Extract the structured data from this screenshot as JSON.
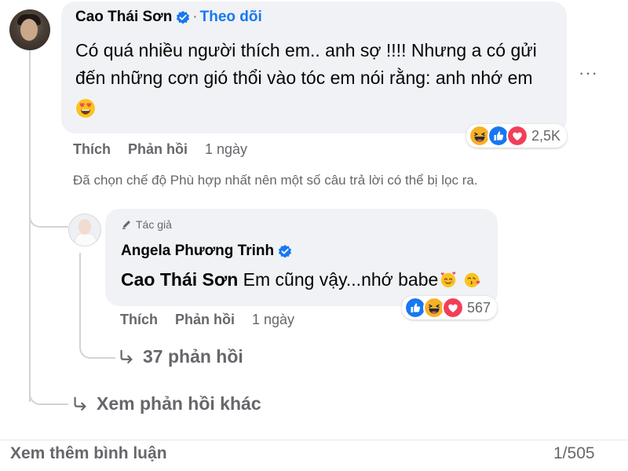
{
  "colors": {
    "bubble": "#f0f2f5",
    "secondary_text": "#65676b",
    "link_blue": "#1877f2",
    "verified_blue": "#1877f2"
  },
  "main_comment": {
    "author": "Cao Thái Sơn",
    "separator": "·",
    "follow_label": "Theo dõi",
    "text_line1": "Có quá nhiều người thích em.. anh sợ !!!! Nhưng a có gửi",
    "text_line2": "đến những cơn gió thổi vào tóc em nói rằng: anh nhớ em",
    "trailing_emoji": "heart-eyes-emoji",
    "more_options_label": "···",
    "reactions": [
      "haha-icon",
      "like-icon",
      "love-icon"
    ],
    "reaction_count": "2,5K",
    "actions": {
      "like": "Thích",
      "reply": "Phản hồi"
    },
    "time": "1 ngày"
  },
  "filter_note": "Đã chọn chế độ Phù hợp nhất nên một số câu trả lời có thể bị lọc ra.",
  "reply": {
    "author_badge": "Tác giả",
    "author": "Angela Phương Trinh",
    "mention": "Cao Thái Sơn",
    "text": "Em cũng vậy...nhớ babe",
    "emojis": [
      "smiling-face-with-hearts-emoji",
      "face-blowing-kiss-emoji"
    ],
    "reactions": [
      "like-icon",
      "haha-icon",
      "love-icon"
    ],
    "reaction_count": "567",
    "actions": {
      "like": "Thích",
      "reply": "Phản hồi"
    },
    "time": "1 ngày",
    "view_replies": "37 phản hồi"
  },
  "view_more_replies": "Xem phản hồi khác",
  "footer": {
    "see_more_comments": "Xem thêm bình luận",
    "pager": "1/505"
  }
}
